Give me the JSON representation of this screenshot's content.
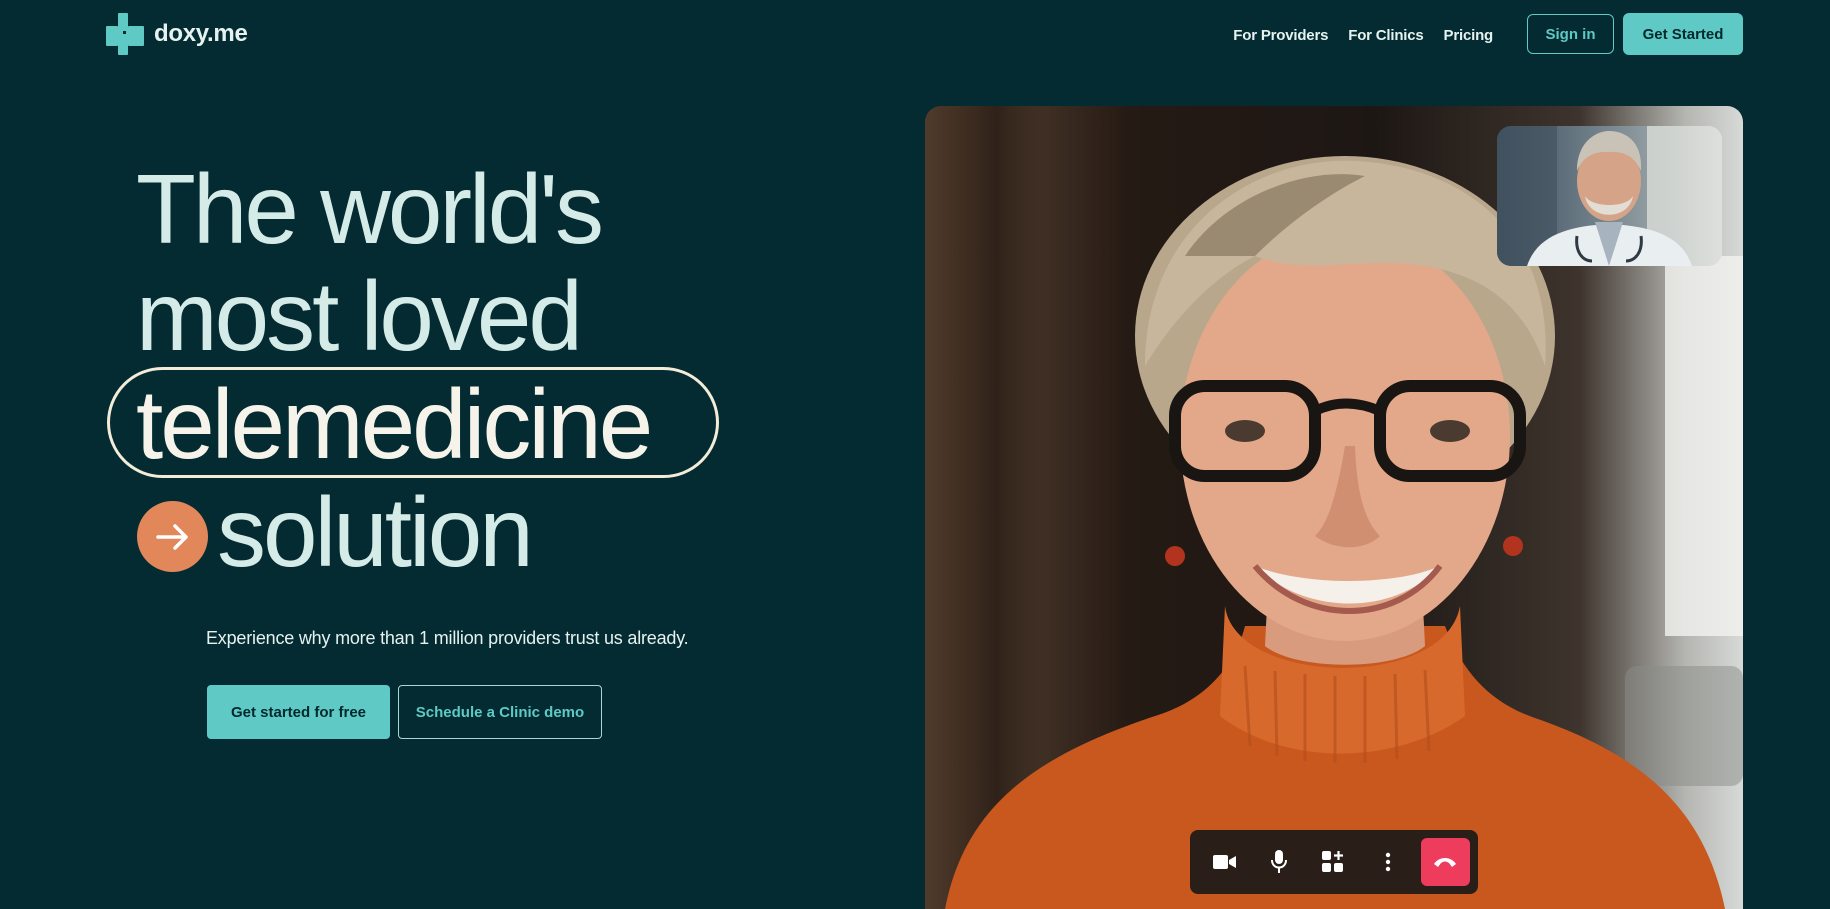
{
  "brand": {
    "name": "doxy.me"
  },
  "nav": {
    "links": [
      "For Providers",
      "For Clinics",
      "Pricing"
    ],
    "sign_in": "Sign in",
    "get_started": "Get Started"
  },
  "hero": {
    "line1": "The world's",
    "line2": "most loved",
    "line3": "telemedicine",
    "line4": "solution",
    "subtext": "Experience why more than 1 million providers trust us already.",
    "cta_primary": "Get started for free",
    "cta_secondary": "Schedule a Clinic demo"
  },
  "video_call": {
    "controls": [
      "video-camera-icon",
      "microphone-icon",
      "apps-add-icon",
      "more-vertical-icon",
      "end-call-icon"
    ]
  },
  "colors": {
    "background": "#032b31",
    "accent": "#5fcac5",
    "arrow": "#e2875a",
    "end_call": "#ee3c5d"
  }
}
